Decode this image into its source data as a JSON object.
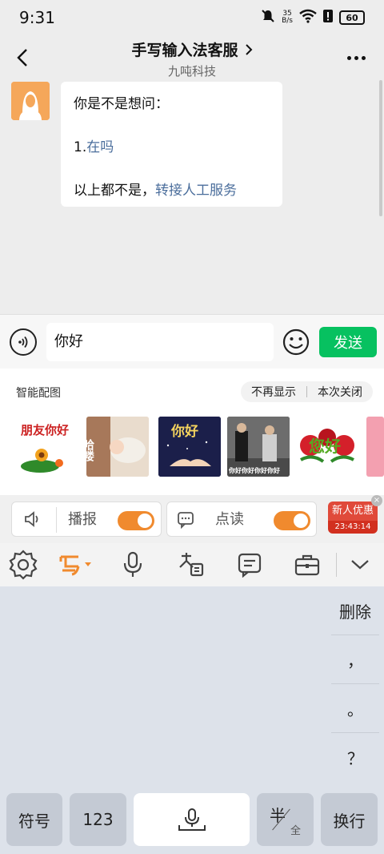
{
  "status_bar": {
    "time": "9:31",
    "net_speed_value": "35",
    "net_speed_unit": "B/s",
    "battery": "60"
  },
  "header": {
    "title": "手写输入法客服",
    "subtitle": "九吨科技"
  },
  "chat": {
    "message": {
      "line1": "你是不是想问：",
      "option_number": "1.",
      "option_link": "在吗",
      "footer_text": "以上都不是，",
      "footer_link": "转接人工服务"
    }
  },
  "input_bar": {
    "text": "你好",
    "send_label": "发送"
  },
  "sticker_panel": {
    "title": "智能配图",
    "hide_forever": "不再显示",
    "close_once": "本次关闭",
    "stickers": [
      {
        "text": "朋友你好",
        "bg": "#ffffff"
      },
      {
        "text": "哈喽",
        "bg": "#e9dccd"
      },
      {
        "text": "你好",
        "bg": "#1b1f4a"
      },
      {
        "text": "你好你好你好你好",
        "bg": "#3b3b3b"
      },
      {
        "text": "您好",
        "bg": "#ffffff"
      }
    ]
  },
  "tts_bar": {
    "broadcast_label": "播报",
    "read_label": "点读",
    "broadcast_on": true,
    "read_on": true,
    "promo_title": "新人优惠",
    "promo_time": "23:43:14"
  },
  "keyboard": {
    "side_keys": [
      "删除",
      "，",
      "。",
      "？"
    ],
    "symbol_key": "符号",
    "number_key": "123",
    "half_key_main": "半",
    "half_key_sub": "全",
    "enter_key": "换行"
  },
  "colors": {
    "send_green": "#07c160",
    "accent_orange": "#f08a2e",
    "link_blue": "#4b6e9c"
  }
}
